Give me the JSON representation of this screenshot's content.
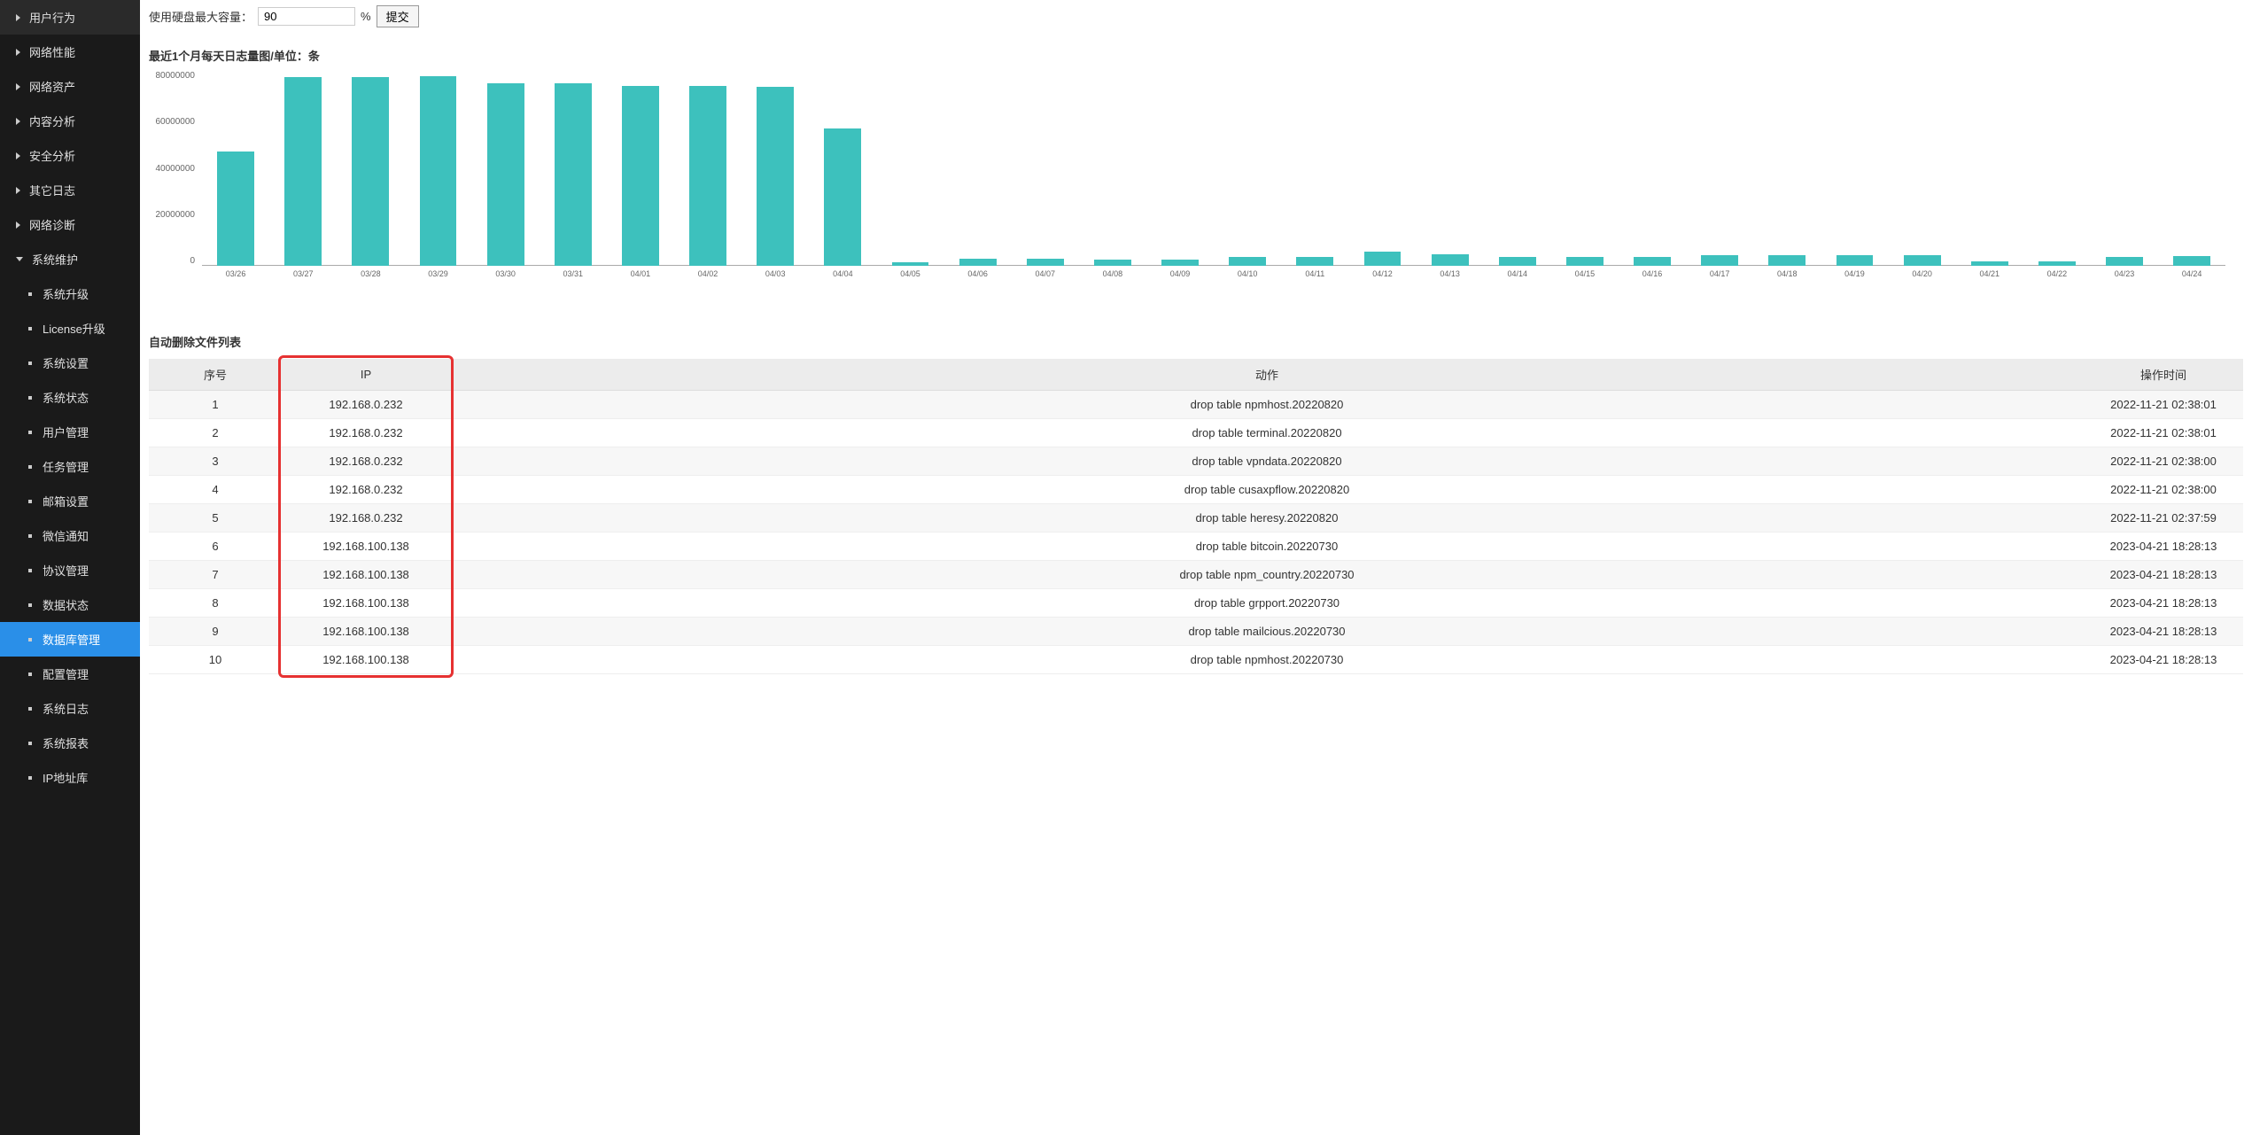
{
  "sidebar": {
    "top_items": [
      {
        "label": "用户行为"
      },
      {
        "label": "网络性能"
      },
      {
        "label": "网络资产"
      },
      {
        "label": "内容分析"
      },
      {
        "label": "安全分析"
      },
      {
        "label": "其它日志"
      },
      {
        "label": "网络诊断"
      }
    ],
    "expanded_label": "系统维护",
    "sub_items": [
      {
        "label": "系统升级"
      },
      {
        "label": "License升级"
      },
      {
        "label": "系统设置"
      },
      {
        "label": "系统状态"
      },
      {
        "label": "用户管理"
      },
      {
        "label": "任务管理"
      },
      {
        "label": "邮箱设置"
      },
      {
        "label": "微信通知"
      },
      {
        "label": "协议管理"
      },
      {
        "label": "数据状态"
      },
      {
        "label": "数据库管理",
        "active": true
      },
      {
        "label": "配置管理"
      },
      {
        "label": "系统日志"
      },
      {
        "label": "系统报表"
      },
      {
        "label": "IP地址库"
      }
    ]
  },
  "disk": {
    "label": "使用硬盘最大容量：",
    "value": "90",
    "unit": "%",
    "submit": "提交"
  },
  "chart_title": "最近1个月每天日志量图/单位：条",
  "chart_data": {
    "type": "bar",
    "title": "最近1个月每天日志量图/单位：条",
    "xlabel": "",
    "ylabel": "",
    "ylim": [
      0,
      80000000
    ],
    "y_ticks": [
      80000000,
      60000000,
      40000000,
      20000000,
      0
    ],
    "categories": [
      "03/26",
      "03/27",
      "03/28",
      "03/29",
      "03/30",
      "03/31",
      "04/01",
      "04/02",
      "04/03",
      "04/04",
      "04/05",
      "04/06",
      "04/07",
      "04/08",
      "04/09",
      "04/10",
      "04/11",
      "04/12",
      "04/13",
      "04/14",
      "04/15",
      "04/16",
      "04/17",
      "04/18",
      "04/19",
      "04/20",
      "04/21",
      "04/22",
      "04/23",
      "04/24"
    ],
    "values": [
      47000000,
      77500000,
      77500000,
      78000000,
      75000000,
      75000000,
      74000000,
      74000000,
      73500000,
      56500000,
      1500000,
      2800000,
      2800000,
      2500000,
      2500000,
      3500000,
      3800000,
      5700000,
      4800000,
      3800000,
      3500000,
      3800000,
      4200000,
      4500000,
      4500000,
      4500000,
      2000000,
      2000000,
      3500000,
      4000000
    ]
  },
  "table": {
    "title": "自动删除文件列表",
    "headers": {
      "seq": "序号",
      "ip": "IP",
      "action": "动作",
      "time": "操作时间"
    },
    "rows": [
      {
        "seq": "1",
        "ip": "192.168.0.232",
        "action": "drop table npmhost.20220820",
        "time": "2022-11-21 02:38:01"
      },
      {
        "seq": "2",
        "ip": "192.168.0.232",
        "action": "drop table terminal.20220820",
        "time": "2022-11-21 02:38:01"
      },
      {
        "seq": "3",
        "ip": "192.168.0.232",
        "action": "drop table vpndata.20220820",
        "time": "2022-11-21 02:38:00"
      },
      {
        "seq": "4",
        "ip": "192.168.0.232",
        "action": "drop table cusaxpflow.20220820",
        "time": "2022-11-21 02:38:00"
      },
      {
        "seq": "5",
        "ip": "192.168.0.232",
        "action": "drop table heresy.20220820",
        "time": "2022-11-21 02:37:59"
      },
      {
        "seq": "6",
        "ip": "192.168.100.138",
        "action": "drop table bitcoin.20220730",
        "time": "2023-04-21 18:28:13"
      },
      {
        "seq": "7",
        "ip": "192.168.100.138",
        "action": "drop table npm_country.20220730",
        "time": "2023-04-21 18:28:13"
      },
      {
        "seq": "8",
        "ip": "192.168.100.138",
        "action": "drop table grpport.20220730",
        "time": "2023-04-21 18:28:13"
      },
      {
        "seq": "9",
        "ip": "192.168.100.138",
        "action": "drop table mailcious.20220730",
        "time": "2023-04-21 18:28:13"
      },
      {
        "seq": "10",
        "ip": "192.168.100.138",
        "action": "drop table npmhost.20220730",
        "time": "2023-04-21 18:28:13"
      }
    ]
  }
}
